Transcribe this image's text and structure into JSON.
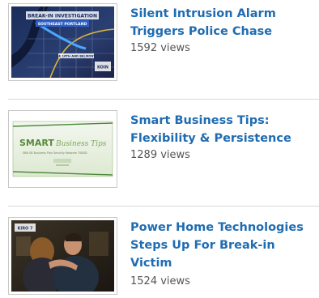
{
  "videos": [
    {
      "title": "Silent Intrusion Alarm Triggers Police Chase",
      "views": "1592 views",
      "thumbnail": {
        "icon": "news-map-thumbnail",
        "banner": "BREAK-IN INVESTIGATION",
        "subbanner": "SOUTHEAST PORTLAND",
        "street": "SE 16TH AND BELMONT",
        "logo": "KOIN"
      }
    },
    {
      "title": "Smart Business Tips: Flexibility & Persistence",
      "views": "1289 views",
      "thumbnail": {
        "icon": "smart-business-slide-thumbnail",
        "brand": "SMART",
        "brand_script": "Business Tips",
        "tagline": "SBN SB Business Plan Security Network TSBSD"
      }
    },
    {
      "title": "Power Home Technologies Steps Up For Break-in Victim",
      "views": "1524 views",
      "thumbnail": {
        "icon": "hug-scene-thumbnail",
        "logo": "KIRO 7"
      }
    }
  ],
  "colors": {
    "link": "#1f6cb2",
    "meta": "#555555",
    "divider": "#d8d8d8"
  }
}
